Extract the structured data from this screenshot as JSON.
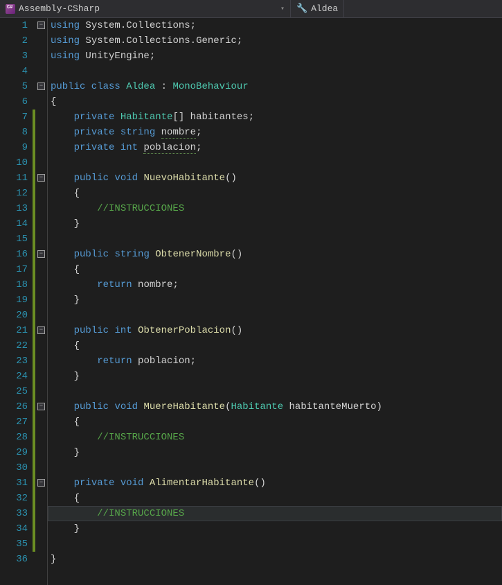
{
  "header": {
    "project": "Assembly-CSharp",
    "class": "Aldea"
  },
  "code": {
    "lines": [
      {
        "n": 1,
        "fold": "minus",
        "tokens": [
          [
            "kw",
            "using"
          ],
          [
            "default",
            " System"
          ],
          [
            "punct",
            "."
          ],
          [
            "default",
            "Collections"
          ],
          [
            "punct",
            ";"
          ]
        ]
      },
      {
        "n": 2,
        "tokens": [
          [
            "kw",
            "using"
          ],
          [
            "default",
            " System"
          ],
          [
            "punct",
            "."
          ],
          [
            "default",
            "Collections"
          ],
          [
            "punct",
            "."
          ],
          [
            "default",
            "Generic"
          ],
          [
            "punct",
            ";"
          ]
        ]
      },
      {
        "n": 3,
        "tokens": [
          [
            "kw",
            "using"
          ],
          [
            "default",
            " UnityEngine"
          ],
          [
            "punct",
            ";"
          ]
        ]
      },
      {
        "n": 4,
        "tokens": []
      },
      {
        "n": 5,
        "fold": "minus",
        "tokens": [
          [
            "kw",
            "public class "
          ],
          [
            "type",
            "Aldea"
          ],
          [
            "default",
            " "
          ],
          [
            "punct",
            ":"
          ],
          [
            "default",
            " "
          ],
          [
            "type",
            "MonoBehaviour"
          ]
        ]
      },
      {
        "n": 6,
        "tokens": [
          [
            "punct",
            "{"
          ]
        ]
      },
      {
        "n": 7,
        "changed": true,
        "indent": 1,
        "tokens": [
          [
            "default",
            "    "
          ],
          [
            "kw",
            "private"
          ],
          [
            "default",
            " "
          ],
          [
            "type",
            "Habitante"
          ],
          [
            "punct",
            "[]"
          ],
          [
            "default",
            " habitantes"
          ],
          [
            "punct",
            ";"
          ]
        ]
      },
      {
        "n": 8,
        "changed": true,
        "indent": 1,
        "tokens": [
          [
            "default",
            "    "
          ],
          [
            "kw",
            "private"
          ],
          [
            "default",
            " "
          ],
          [
            "kw",
            "string"
          ],
          [
            "default",
            " "
          ],
          [
            "spell",
            "nombre"
          ],
          [
            "punct",
            ";"
          ]
        ]
      },
      {
        "n": 9,
        "changed": true,
        "indent": 1,
        "tokens": [
          [
            "default",
            "    "
          ],
          [
            "kw",
            "private"
          ],
          [
            "default",
            " "
          ],
          [
            "kw",
            "int"
          ],
          [
            "default",
            " "
          ],
          [
            "spell",
            "poblacion"
          ],
          [
            "punct",
            ";"
          ]
        ]
      },
      {
        "n": 10,
        "changed": true,
        "indent": 1,
        "tokens": []
      },
      {
        "n": 11,
        "changed": true,
        "fold": "minus",
        "indent": 1,
        "tokens": [
          [
            "default",
            "    "
          ],
          [
            "kw",
            "public"
          ],
          [
            "default",
            " "
          ],
          [
            "kw",
            "void"
          ],
          [
            "default",
            " "
          ],
          [
            "ident",
            "NuevoHabitante"
          ],
          [
            "punct",
            "()"
          ]
        ]
      },
      {
        "n": 12,
        "changed": true,
        "indent": 1,
        "tokens": [
          [
            "default",
            "    "
          ],
          [
            "punct",
            "{"
          ]
        ]
      },
      {
        "n": 13,
        "changed": true,
        "indent": 2,
        "tokens": [
          [
            "default",
            "        "
          ],
          [
            "comment",
            "//INSTRUCCIONES"
          ]
        ]
      },
      {
        "n": 14,
        "changed": true,
        "indent": 1,
        "tokens": [
          [
            "default",
            "    "
          ],
          [
            "punct",
            "}"
          ]
        ]
      },
      {
        "n": 15,
        "changed": true,
        "indent": 1,
        "tokens": []
      },
      {
        "n": 16,
        "changed": true,
        "fold": "minus",
        "indent": 1,
        "tokens": [
          [
            "default",
            "    "
          ],
          [
            "kw",
            "public"
          ],
          [
            "default",
            " "
          ],
          [
            "kw",
            "string"
          ],
          [
            "default",
            " "
          ],
          [
            "ident",
            "ObtenerNombre"
          ],
          [
            "punct",
            "()"
          ]
        ]
      },
      {
        "n": 17,
        "changed": true,
        "indent": 1,
        "tokens": [
          [
            "default",
            "    "
          ],
          [
            "punct",
            "{"
          ]
        ]
      },
      {
        "n": 18,
        "changed": true,
        "indent": 2,
        "tokens": [
          [
            "default",
            "        "
          ],
          [
            "kw",
            "return"
          ],
          [
            "default",
            " nombre"
          ],
          [
            "punct",
            ";"
          ]
        ]
      },
      {
        "n": 19,
        "changed": true,
        "indent": 1,
        "tokens": [
          [
            "default",
            "    "
          ],
          [
            "punct",
            "}"
          ]
        ]
      },
      {
        "n": 20,
        "changed": true,
        "indent": 1,
        "tokens": []
      },
      {
        "n": 21,
        "changed": true,
        "fold": "minus",
        "indent": 1,
        "tokens": [
          [
            "default",
            "    "
          ],
          [
            "kw",
            "public"
          ],
          [
            "default",
            " "
          ],
          [
            "kw",
            "int"
          ],
          [
            "default",
            " "
          ],
          [
            "ident",
            "ObtenerPoblacion"
          ],
          [
            "punct",
            "()"
          ]
        ]
      },
      {
        "n": 22,
        "changed": true,
        "indent": 1,
        "tokens": [
          [
            "default",
            "    "
          ],
          [
            "punct",
            "{"
          ]
        ]
      },
      {
        "n": 23,
        "changed": true,
        "indent": 2,
        "tokens": [
          [
            "default",
            "        "
          ],
          [
            "kw",
            "return"
          ],
          [
            "default",
            " poblacion"
          ],
          [
            "punct",
            ";"
          ]
        ]
      },
      {
        "n": 24,
        "changed": true,
        "indent": 1,
        "tokens": [
          [
            "default",
            "    "
          ],
          [
            "punct",
            "}"
          ]
        ]
      },
      {
        "n": 25,
        "changed": true,
        "indent": 1,
        "tokens": []
      },
      {
        "n": 26,
        "changed": true,
        "fold": "minus",
        "indent": 1,
        "tokens": [
          [
            "default",
            "    "
          ],
          [
            "kw",
            "public"
          ],
          [
            "default",
            " "
          ],
          [
            "kw",
            "void"
          ],
          [
            "default",
            " "
          ],
          [
            "ident",
            "MuereHabitante"
          ],
          [
            "punct",
            "("
          ],
          [
            "type",
            "Habitante"
          ],
          [
            "default",
            " habitanteMuerto"
          ],
          [
            "punct",
            ")"
          ]
        ]
      },
      {
        "n": 27,
        "changed": true,
        "indent": 1,
        "tokens": [
          [
            "default",
            "    "
          ],
          [
            "punct",
            "{"
          ]
        ]
      },
      {
        "n": 28,
        "changed": true,
        "indent": 2,
        "tokens": [
          [
            "default",
            "        "
          ],
          [
            "comment",
            "//INSTRUCCIONES"
          ]
        ]
      },
      {
        "n": 29,
        "changed": true,
        "indent": 1,
        "tokens": [
          [
            "default",
            "    "
          ],
          [
            "punct",
            "}"
          ]
        ]
      },
      {
        "n": 30,
        "changed": true,
        "indent": 1,
        "tokens": []
      },
      {
        "n": 31,
        "changed": true,
        "fold": "minus",
        "indent": 1,
        "tokens": [
          [
            "default",
            "    "
          ],
          [
            "kw",
            "private"
          ],
          [
            "default",
            " "
          ],
          [
            "kw",
            "void"
          ],
          [
            "default",
            " "
          ],
          [
            "ident",
            "AlimentarHabitante"
          ],
          [
            "punct",
            "()"
          ]
        ]
      },
      {
        "n": 32,
        "changed": true,
        "indent": 1,
        "tokens": [
          [
            "default",
            "    "
          ],
          [
            "punct",
            "{"
          ]
        ]
      },
      {
        "n": 33,
        "changed": true,
        "current": true,
        "indent": 2,
        "tokens": [
          [
            "default",
            "        "
          ],
          [
            "comment",
            "//INSTRUCCIONES"
          ]
        ]
      },
      {
        "n": 34,
        "changed": true,
        "indent": 1,
        "tokens": [
          [
            "default",
            "    "
          ],
          [
            "punct",
            "}"
          ]
        ]
      },
      {
        "n": 35,
        "changed": true,
        "indent": 1,
        "tokens": []
      },
      {
        "n": 36,
        "tokens": [
          [
            "punct",
            "}"
          ]
        ]
      }
    ]
  }
}
